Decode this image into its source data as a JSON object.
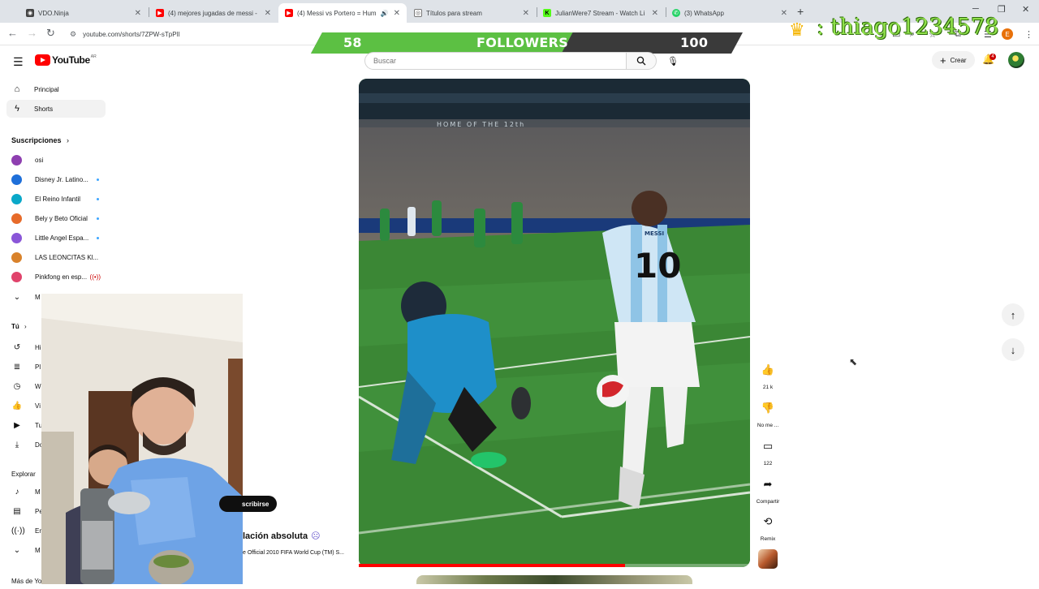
{
  "browser": {
    "tabs": [
      {
        "title": "VDO.Ninja",
        "icon": "vdo-ninja-icon",
        "active": false
      },
      {
        "title": "(4) mejores jugadas de messi -",
        "icon": "youtube-icon",
        "active": false
      },
      {
        "title": "(4) Messi vs Portero = Hum",
        "icon": "youtube-icon",
        "active": true
      },
      {
        "title": "Títulos para stream",
        "icon": "globe-icon",
        "active": false
      },
      {
        "title": "JulianWere7 Stream - Watch Li",
        "icon": "kick-icon",
        "active": false
      },
      {
        "title": "(3) WhatsApp",
        "icon": "whatsapp-icon",
        "active": false
      }
    ],
    "url": "youtube.com/shorts/7ZPW-sTpPlI",
    "profile_initial": "E"
  },
  "stream_overlay": {
    "followers_current": "58",
    "followers_label": "FOLLOWERS",
    "followers_goal": "100",
    "goal_progress": 0.58,
    "crown_icon": "crown-icon",
    "handle": ": thiago1234578"
  },
  "youtube": {
    "logo_text": "YouTube",
    "country_code": "AR",
    "search_placeholder": "Buscar",
    "create_label": "Crear",
    "notification_count": "4"
  },
  "sidebar": {
    "main": [
      {
        "label": "Principal",
        "icon": "home-icon",
        "selected": false
      },
      {
        "label": "Shorts",
        "icon": "shorts-icon",
        "selected": true
      }
    ],
    "subscriptions_header": "Suscripciones",
    "subscriptions": [
      {
        "name": "osi",
        "color": "#8e3fb0",
        "indicator": "none"
      },
      {
        "name": "Disney Jr. Latino...",
        "color": "#1e6fd9",
        "indicator": "dot"
      },
      {
        "name": "El Reino Infantil",
        "color": "#0aa8c9",
        "indicator": "dot"
      },
      {
        "name": "Bely y Beto Oficial",
        "color": "#e76b2a",
        "indicator": "dot"
      },
      {
        "name": "Little Angel Espa...",
        "color": "#8a56d8",
        "indicator": "dot"
      },
      {
        "name": "LAS LEONCITAS Kl...",
        "color": "#d9822b",
        "indicator": "none"
      },
      {
        "name": "Pinkfong en esp...",
        "color": "#e0436b",
        "indicator": "live"
      }
    ],
    "show_more_initial": "M",
    "you_header": "Tú",
    "you_items": [
      {
        "initial": "Hi",
        "icon": "history-icon"
      },
      {
        "initial": "Pl",
        "icon": "playlist-icon"
      },
      {
        "initial": "W",
        "icon": "watch-later-icon"
      },
      {
        "initial": "Vi",
        "icon": "liked-icon"
      },
      {
        "initial": "Tu",
        "icon": "your-videos-icon"
      },
      {
        "initial": "Do",
        "icon": "download-icon"
      }
    ],
    "explore_header": "Explorar",
    "explore_items": [
      {
        "initial": "M",
        "icon": "music-icon"
      },
      {
        "initial": "Pe",
        "icon": "movies-icon"
      },
      {
        "initial": "En",
        "icon": "live-icon"
      },
      {
        "initial": "M",
        "icon": "chevron-down-icon"
      }
    ],
    "more_from": "Más de Yo"
  },
  "short": {
    "subscribe_label": "scribirse",
    "title": "lación absoluta",
    "music": "e Official 2010 FIFA World Cup (TM) S...",
    "progress": 0.68,
    "actions": [
      {
        "name": "like",
        "icon": "thumbs-up-icon",
        "caption": "21 k"
      },
      {
        "name": "dislike",
        "icon": "thumbs-down-icon",
        "caption": "No me ..."
      },
      {
        "name": "comments",
        "icon": "comment-icon",
        "caption": "122"
      },
      {
        "name": "share",
        "icon": "share-icon",
        "caption": "Compartir"
      },
      {
        "name": "remix",
        "icon": "remix-icon",
        "caption": "Remix"
      }
    ],
    "stadium_banner": "HOME OF THE 12th",
    "jersey_name": "MESSI",
    "jersey_number": "10"
  },
  "colors": {
    "youtube_red": "#ff0000",
    "goal_bar_green": "#5cc043",
    "handle_green": "#8fe04a"
  }
}
